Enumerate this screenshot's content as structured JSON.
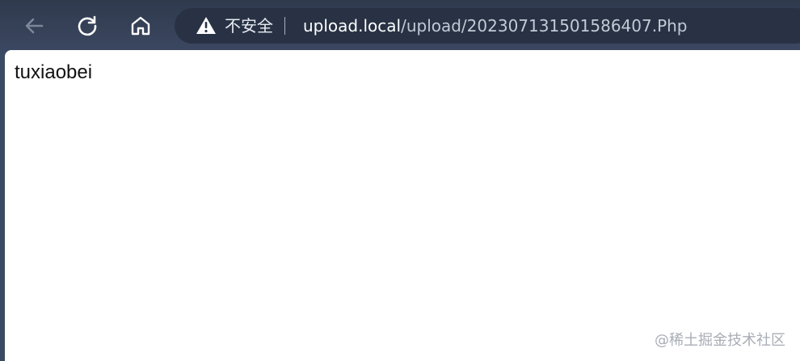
{
  "browser": {
    "nav": {
      "back_icon": "arrow-left-icon",
      "reload_icon": "reload-icon",
      "home_icon": "home-icon"
    },
    "address_bar": {
      "security_label": "不安全",
      "url_host": "upload.local",
      "url_path": "/upload/20230713150158640​7.Php"
    }
  },
  "page": {
    "text": "tuxiaobei"
  },
  "watermark": {
    "text": "@稀土掘金技术社区"
  },
  "colors": {
    "toolbar": "#334059",
    "address_bar": "#283244",
    "content_bg": "#ffffff"
  }
}
